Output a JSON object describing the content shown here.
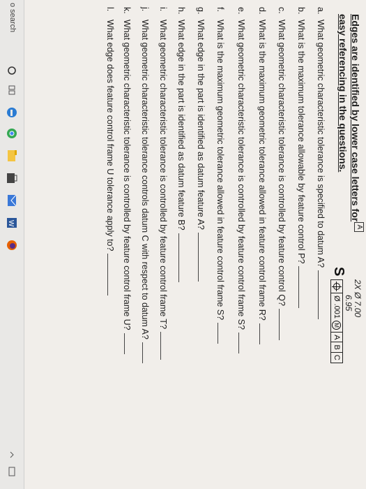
{
  "heading": {
    "line1": "Edges are identified by lower case letters for",
    "line2": "easy referencing in the questions."
  },
  "callout": {
    "datum_tag": "A",
    "dimension_line1": "2X Ø 7.00",
    "dimension_line2": "6.95",
    "feature_label": "S",
    "tolerance": "Ø .001",
    "modifier": "M",
    "datums": [
      "A",
      "B",
      "C"
    ]
  },
  "questions": [
    {
      "letter": "a.",
      "text": "What geometric characteristic tolerance is specified to datum A?"
    },
    {
      "letter": "b.",
      "text": "What is the maximum tolerance allowable by feature control P?"
    },
    {
      "letter": "c.",
      "text": "What geometric characteristic tolerance is controlled by feature control Q?"
    },
    {
      "letter": "d.",
      "text": "What is the maximum geometric tolerance allowed in feature control frame R?"
    },
    {
      "letter": "e.",
      "text": "What geometric characteristic tolerance is controlled by feature control frame S?"
    },
    {
      "letter": "f.",
      "text": "What is the maximum geometric tolerance allowed in feature control frame S?"
    },
    {
      "letter": "g.",
      "text": "What edge in the part is identified as datum feature A?"
    },
    {
      "letter": "h.",
      "text": "What edge in the part is identified as datum feature B?"
    },
    {
      "letter": "i.",
      "text": "What geometric characteristic tolerance is controlled by feature control frame T?"
    },
    {
      "letter": "j.",
      "text": "What geometric characteristic tolerance controls datum C with respect to datum A?"
    },
    {
      "letter": "k.",
      "text": "What geometric characteristic tolerance is controlled by feature control frame U?"
    },
    {
      "letter": "l.",
      "text": "What edge does feature control frame U tolerance apply to?"
    }
  ],
  "taskbar": {
    "search_label": "o search",
    "icons": [
      "cortana-icon",
      "task-view-icon",
      "edge-browser-icon",
      "chrome-icon",
      "file-explorer-icon",
      "store-icon",
      "mail-icon",
      "word-icon",
      "firefox-icon"
    ],
    "colors": {
      "edge": "#2b7cd3",
      "chrome": "#34a853",
      "explorer": "#f4c542",
      "store": "#444444",
      "mail": "#3a78d8",
      "word": "#2b579a",
      "firefox": "#e66000"
    }
  }
}
